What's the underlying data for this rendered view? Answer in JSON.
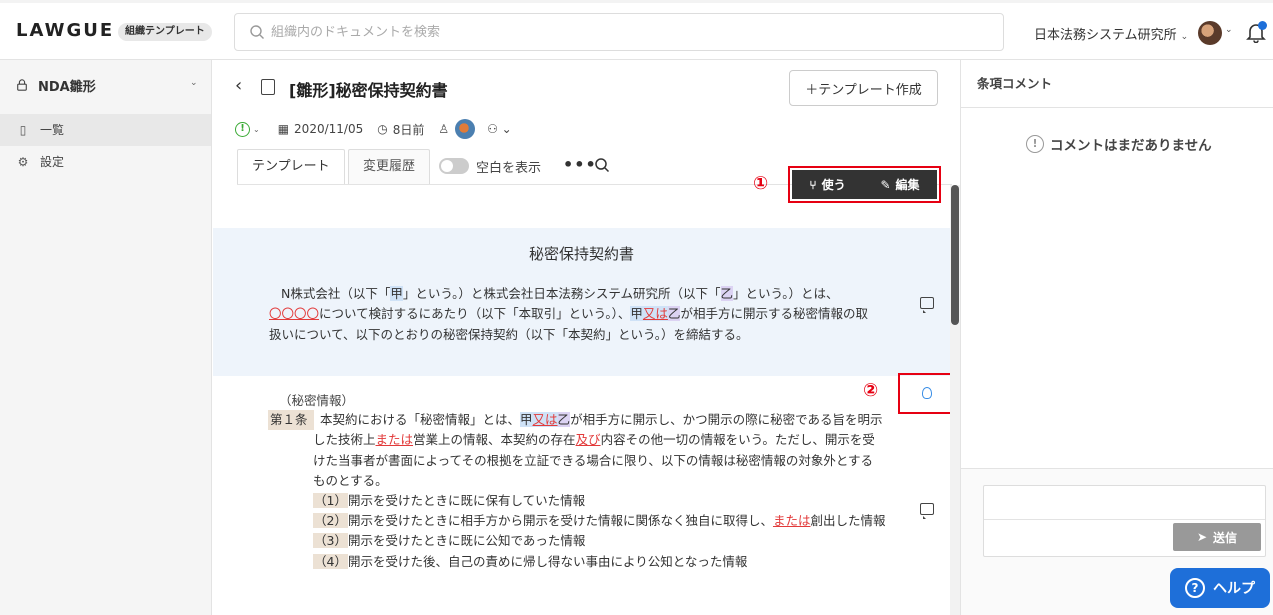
{
  "header": {
    "logo": "LAWGUE",
    "org_badge": "組織テンプレート",
    "search_placeholder": "組織内のドキュメントを検索",
    "org_name": "日本法務システム研究所",
    "accent_color": "#1e6fd9"
  },
  "sidebar": {
    "title": "NDA雛形",
    "items": [
      {
        "label": "一覧",
        "icon": "book-icon",
        "active": true
      },
      {
        "label": "設定",
        "icon": "gear-icon",
        "active": false
      }
    ]
  },
  "document": {
    "title": "[雛形]秘密保持契約書",
    "create_template_label": "＋テンプレート作成",
    "date": "2020/11/05",
    "relative_time": "8日前",
    "tabs": [
      {
        "label": "テンプレート",
        "active": true
      },
      {
        "label": "変更履歴",
        "active": false
      }
    ],
    "toggle_label": "空白を表示",
    "more_label": "•••",
    "use_label": "使う",
    "edit_label": "編集",
    "annotation_1": "①",
    "annotation_2": "②",
    "contract_title": "秘密保持契約書",
    "intro": {
      "l1_a": "N株式会社（以下「",
      "l1_kou": "甲",
      "l1_b": "」という。）と株式会社日本法務システム研究所（以下「",
      "l1_otsu": "乙",
      "l1_c": "」という。）とは、",
      "l2_a": "〇〇〇〇",
      "l2_b": "について検討するにあたり（以下「本取引」という。）、",
      "l2_kou": "甲",
      "l2_mata": "又は",
      "l2_otsu": "乙",
      "l2_c": "が相手方に開示する秘密情報の取",
      "l3": "扱いについて、以下のとおりの秘密保持契約（以下「本契約」という。）を締結する。"
    },
    "article1": {
      "heading": "（秘密情報）",
      "label": "第１条",
      "l1_a": "本契約における「秘密情報」とは、",
      "l1_kou": "甲",
      "l1_mata": "又は",
      "l1_otsu": "乙",
      "l1_b": "が相手方に開示し、かつ開示の際に秘密である旨を明示",
      "l2_a": "した技術上",
      "l2_mataha": "または",
      "l2_b": "営業上の情報、本契約の存在",
      "l2_oyobi": "及び",
      "l2_c": "内容その他一切の情報をいう。ただし、開示を受",
      "l3": "けた当事者が書面によってその根拠を立証できる場合に限り、以下の情報は秘密情報の対象外とする",
      "l4": "ものとする。",
      "items": [
        {
          "num": "（1）",
          "text": "開示を受けたときに既に保有していた情報"
        },
        {
          "num": "（2）",
          "text_a": "開示を受けたときに相手方から開示を受けた情報に関係なく独自に取得し、",
          "text_red": "または",
          "text_b": "創出した情報"
        },
        {
          "num": "（3）",
          "text": "開示を受けたときに既に公知であった情報"
        },
        {
          "num": "（4）",
          "text": "開示を受けた後、自己の責めに帰し得ない事由により公知となった情報"
        }
      ]
    }
  },
  "right_panel": {
    "title": "条項コメント",
    "empty_message": "コメントはまだありません",
    "send_label": "送信",
    "help_label": "ヘルプ"
  }
}
